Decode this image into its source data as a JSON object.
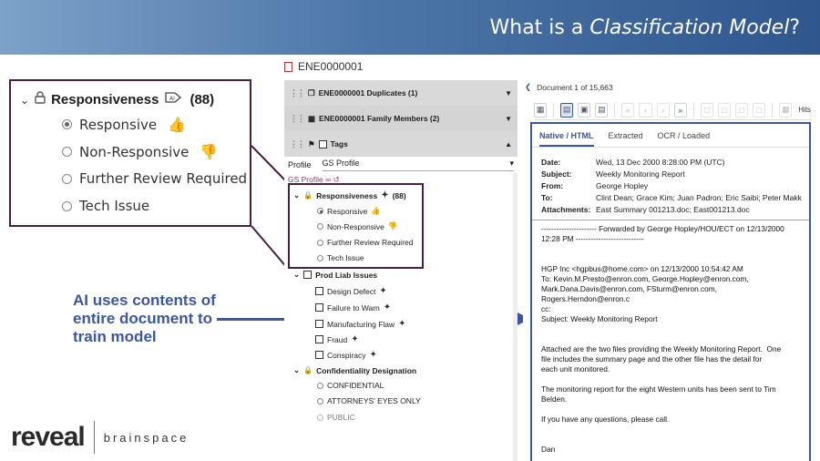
{
  "slide": {
    "title_prefix": "What is a ",
    "title_em": "Classification Model",
    "title_suffix": "?"
  },
  "zoom": {
    "field": "Responsiveness",
    "count": "(88)",
    "options": [
      {
        "label": "Responsive",
        "selected": true,
        "icon": "thumbs-up-icon"
      },
      {
        "label": "Non-Responsive",
        "selected": false,
        "icon": "thumbs-down-icon"
      },
      {
        "label": "Further Review Required",
        "selected": false,
        "icon": ""
      },
      {
        "label": "Tech Issue",
        "selected": false,
        "icon": ""
      }
    ]
  },
  "annotation": "AI uses contents of entire document to train model",
  "logo": {
    "reveal": "reveal",
    "brainspace": "brainspace"
  },
  "middle": {
    "doc_id": "ENE0000001",
    "duplicates": "ENE0000001 Duplicates (1)",
    "family": "ENE0000001 Family Members (2)",
    "tags": "Tags",
    "profile_label": "Profile",
    "profile_value": "GS Profile",
    "gs_profile": "GS Profile",
    "responsiveness": "Responsiveness",
    "resp_count": "(88)",
    "resp_options": [
      "Responsive",
      "Non-Responsive",
      "Further Review Required",
      "Tech Issue"
    ],
    "prod_liab": "Prod Liab Issues",
    "prod_items": [
      "Design Defect",
      "Failure to Warn",
      "Manufacturing Flaw",
      "Fraud",
      "Conspiracy"
    ],
    "conf": "Confidentiality Designation",
    "conf_items": [
      "CONFIDENTIAL",
      "ATTORNEYS' EYES ONLY",
      "PUBLIC"
    ]
  },
  "right": {
    "doc_count": "Document 1 of 15,663",
    "hits": "Hits",
    "tabs": [
      "Native / HTML",
      "Extracted",
      "OCR / Loaded"
    ],
    "meta": [
      {
        "k": "Date:",
        "v": "Wed, 13 Dec 2000 8:28:00 PM (UTC)"
      },
      {
        "k": "Subject:",
        "v": "Weekly Monitoring Report"
      },
      {
        "k": "From:",
        "v": "George Hopley"
      },
      {
        "k": "To:",
        "v": "Clint Dean; Grace Kim; Juan Padron; Eric Saibi; Peter Makk"
      },
      {
        "k": "Attachments:",
        "v": "East Summary 001213.doc; East001213.doc"
      }
    ],
    "body": "---------------------- Forwarded by George Hopley/HOU/ECT on 12/13/2000 12:28 PM ---------------------------\n\n\nHGP Inc <hgpbus@home.com> on 12/13/2000 10:54:42 AM\nTo: Kevin.M.Presto@enron.com, George.Hopley@enron.com,\nMark.Dana.Davis@enron.com, FSturm@enron.com, Rogers.Herndon@enron.c\ncc:\nSubject: Weekly Monitoring Report\n\n\nAttached are the two files providing the Weekly Monitoring Report.  One\nfile includes the summary page and the other file has the detail for\neach unit monitored.\n\nThe monitoring report for the eight Western units has been sent to Tim\nBelden.\n\nIf you have any questions, please call.\n\n\nDan"
  }
}
